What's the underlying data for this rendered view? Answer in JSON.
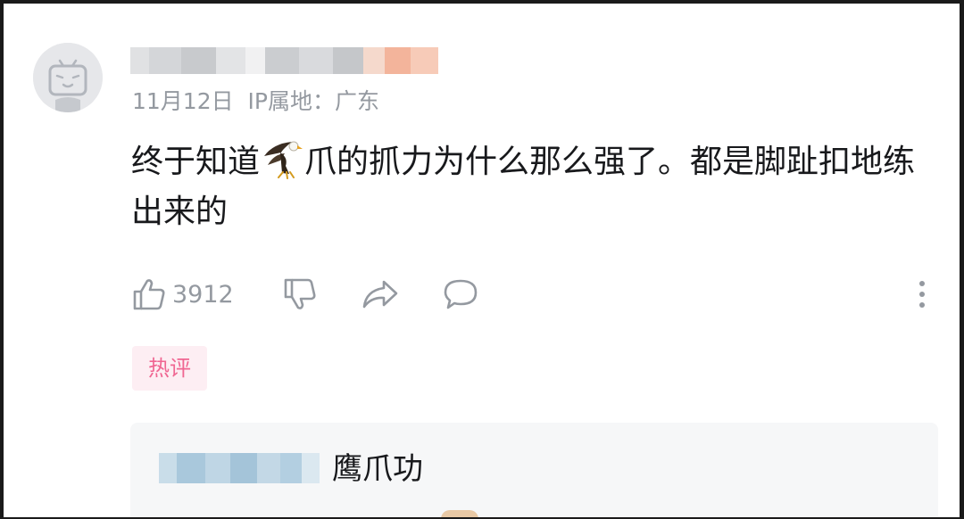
{
  "comment": {
    "date": "11月12日",
    "ip_location": "IP属地：广东",
    "text_before_icon": "终于知道",
    "inline_icon": "eagle-icon",
    "text_after_icon": "爪的抓力为什么那么强了。都是脚趾扣地练出来的",
    "like_count": "3912",
    "badge": "热评"
  },
  "reply": {
    "text": "鹰爪功"
  },
  "colors": {
    "meta_gray": "#9499a0",
    "text_dark": "#18191c",
    "badge_pink": "#f06692",
    "badge_bg": "#fdeef3",
    "reply_bg": "#f6f7f8"
  }
}
